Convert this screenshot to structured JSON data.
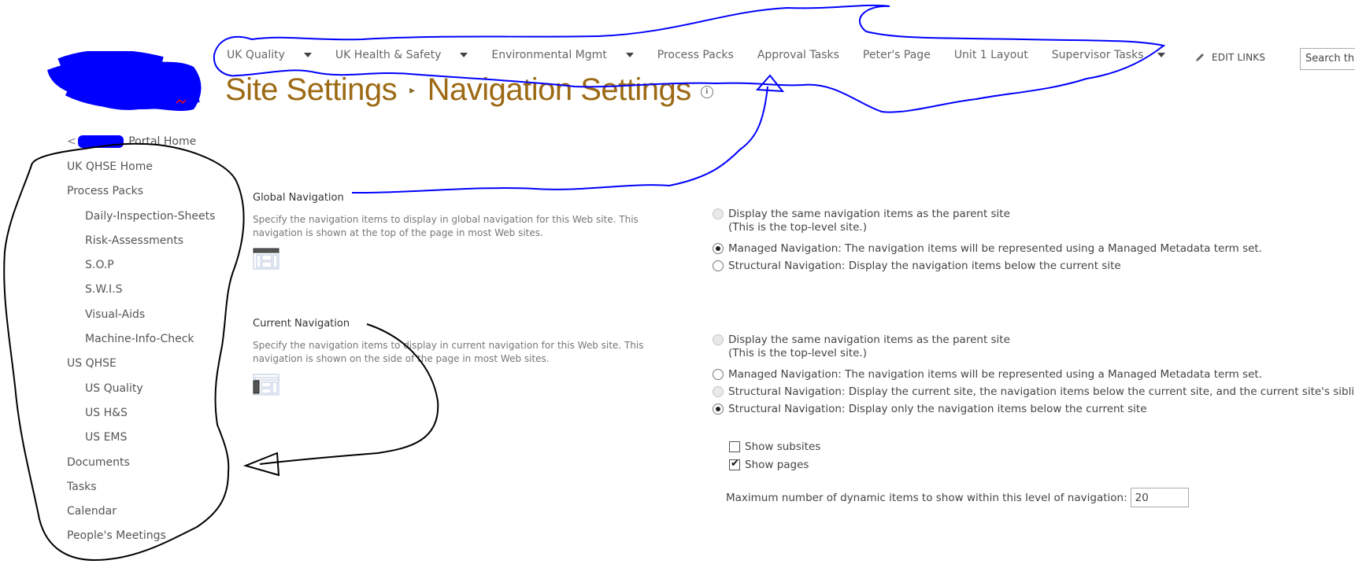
{
  "top_nav": {
    "items": [
      {
        "label": "UK Quality",
        "has_dropdown": true
      },
      {
        "label": "UK Health & Safety",
        "has_dropdown": true
      },
      {
        "label": "Environmental Mgmt",
        "has_dropdown": true
      },
      {
        "label": "Process Packs",
        "has_dropdown": false
      },
      {
        "label": "Approval Tasks",
        "has_dropdown": false
      },
      {
        "label": "Peter's Page",
        "has_dropdown": false
      },
      {
        "label": "Unit 1 Layout",
        "has_dropdown": false
      },
      {
        "label": "Supervisor Tasks",
        "has_dropdown": true
      }
    ],
    "edit_links_label": "EDIT LINKS",
    "search_placeholder": "Search this site"
  },
  "page_title": {
    "parent": "Site Settings",
    "separator": "▸",
    "current": "Navigation Settings",
    "info_icon": "i"
  },
  "left_nav": {
    "back_arrow": "<",
    "portal_home": "Portal Home",
    "items": [
      {
        "label": "UK QHSE Home",
        "level": 0
      },
      {
        "label": "Process Packs",
        "level": 0
      },
      {
        "label": "Daily-Inspection-Sheets",
        "level": 1
      },
      {
        "label": "Risk-Assessments",
        "level": 1
      },
      {
        "label": "S.O.P",
        "level": 1
      },
      {
        "label": "S.W.I.S",
        "level": 1
      },
      {
        "label": "Visual-Aids",
        "level": 1
      },
      {
        "label": "Machine-Info-Check",
        "level": 1
      },
      {
        "label": "US QHSE",
        "level": 0
      },
      {
        "label": "US Quality",
        "level": 1
      },
      {
        "label": "US H&S",
        "level": 1
      },
      {
        "label": "US EMS",
        "level": 1
      },
      {
        "label": "Documents",
        "level": 0
      },
      {
        "label": "Tasks",
        "level": 0
      },
      {
        "label": "Calendar",
        "level": 0
      },
      {
        "label": "People's Meetings",
        "level": 0
      }
    ]
  },
  "global_navigation": {
    "heading": "Global Navigation",
    "description": "Specify the navigation items to display in global navigation for this Web site. This navigation is shown at the top of the page in most Web sites.",
    "icon": "global-navigation-layout-icon",
    "options": [
      {
        "label": "Display the same navigation items as the parent site",
        "subtext": "(This is the top-level site.)",
        "checked": false,
        "disabled": true
      },
      {
        "label": "Managed Navigation: The navigation items will be represented using a Managed Metadata term set.",
        "checked": true,
        "disabled": false
      },
      {
        "label": "Structural Navigation: Display the navigation items below the current site",
        "checked": false,
        "disabled": false
      }
    ]
  },
  "current_navigation": {
    "heading": "Current Navigation",
    "description": "Specify the navigation items to display in current navigation for this Web site. This navigation is shown on the side of the page in most Web sites.",
    "icon": "current-navigation-layout-icon",
    "options": [
      {
        "label": "Display the same navigation items as the parent site",
        "subtext": "(This is the top-level site.)",
        "checked": false,
        "disabled": true
      },
      {
        "label": "Managed Navigation: The navigation items will be represented using a Managed Metadata term set.",
        "checked": false,
        "disabled": false
      },
      {
        "label": "Structural Navigation: Display the current site, the navigation items below the current site, and the current site's siblings",
        "checked": false,
        "disabled": true
      },
      {
        "label": "Structural Navigation: Display only the navigation items below the current site",
        "checked": true,
        "disabled": false
      }
    ],
    "show_subsites": {
      "label": "Show subsites",
      "checked": false
    },
    "show_pages": {
      "label": "Show pages",
      "checked": true
    },
    "max_items": {
      "label": "Maximum number of dynamic items to show within this level of navigation:",
      "value": "20"
    }
  },
  "annotation_colors": {
    "blue_outline": "#0000ff",
    "black_outline": "#000000",
    "highlight": "#ffff00"
  },
  "theme": {
    "title_color": "#9c6a14",
    "nav_text": "#666666"
  }
}
